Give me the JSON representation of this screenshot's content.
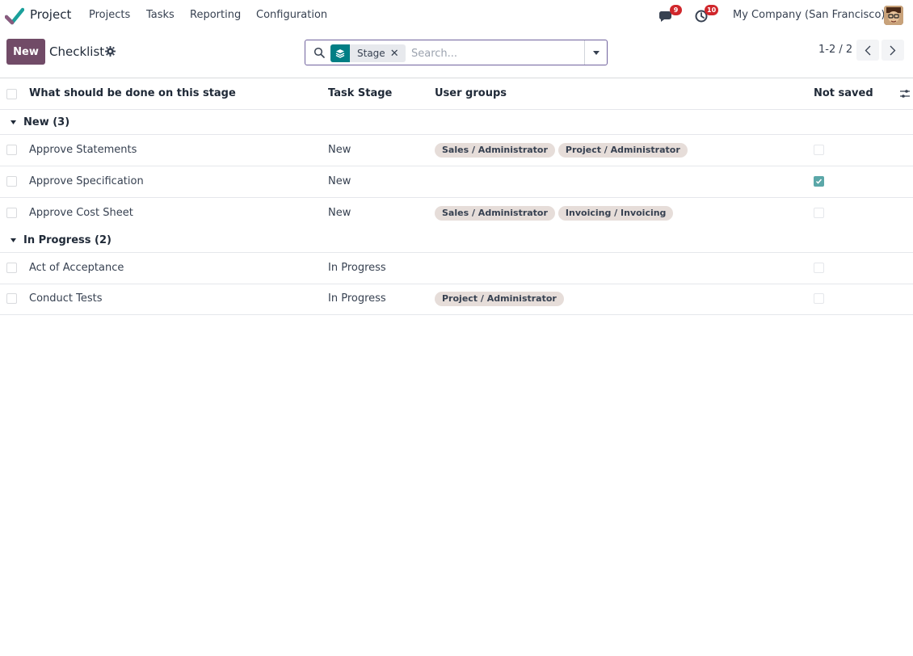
{
  "navbar": {
    "app_name": "Project",
    "menu": [
      "Projects",
      "Tasks",
      "Reporting",
      "Configuration"
    ],
    "messages_badge": "9",
    "activities_badge": "10",
    "company": "My Company (San Francisco)",
    "logo_color": "#1ba09b"
  },
  "control_panel": {
    "new_label": "New",
    "title": "Checklist",
    "search": {
      "facet_label": "Stage",
      "facet_remove": "✕",
      "placeholder": "Search..."
    },
    "pager": {
      "value": "1-2 / 2",
      "prev": "‹",
      "next": "›"
    }
  },
  "table": {
    "columns": {
      "description": "What should be done on this stage",
      "stage": "Task Stage",
      "groups": "User groups",
      "not_saved": "Not saved"
    },
    "groups": [
      {
        "label": "New (3)",
        "rows": [
          {
            "description": "Approve Statements",
            "stage": "New",
            "tags": [
              "Sales / Administrator",
              "Project / Administrator"
            ],
            "not_saved": false
          },
          {
            "description": "Approve Specification",
            "stage": "New",
            "tags": [],
            "not_saved": true
          },
          {
            "description": "Approve Cost Sheet",
            "stage": "New",
            "tags": [
              "Sales / Administrator",
              "Invoicing / Invoicing"
            ],
            "not_saved": false
          }
        ]
      },
      {
        "label": "In Progress (2)",
        "rows": [
          {
            "description": "Act of Acceptance",
            "stage": "In Progress",
            "tags": [],
            "not_saved": false
          },
          {
            "description": "Conduct Tests",
            "stage": "In Progress",
            "tags": [
              "Project / Administrator"
            ],
            "not_saved": false
          }
        ]
      }
    ]
  },
  "colors": {
    "primary": "#714b67",
    "facet_teal": "#017e84",
    "badge_red": "#d0262b",
    "tag_bg": "#e6ddd9"
  }
}
